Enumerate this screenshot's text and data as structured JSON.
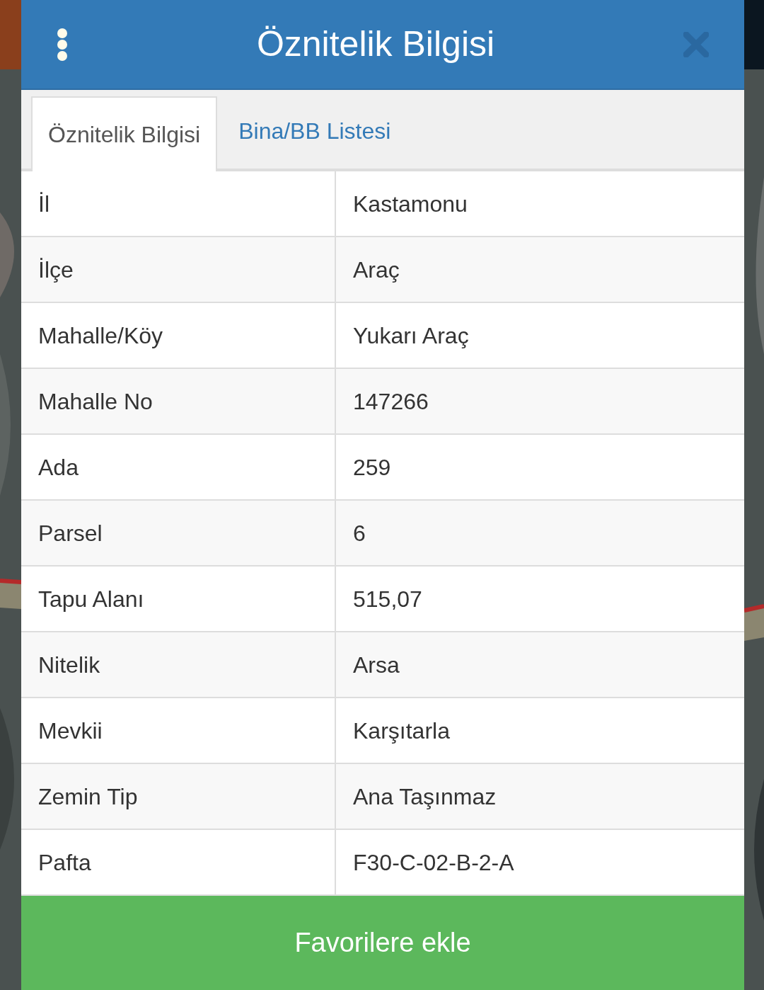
{
  "dialog": {
    "title": "Öznitelik Bilgisi"
  },
  "tabs": [
    {
      "label": "Öznitelik Bilgisi",
      "selected": true
    },
    {
      "label": "Bina/BB Listesi",
      "selected": false
    }
  ],
  "table": {
    "rows": [
      {
        "label": "İl",
        "value": "Kastamonu"
      },
      {
        "label": "İlçe",
        "value": "Araç"
      },
      {
        "label": "Mahalle/Köy",
        "value": "Yukarı Araç"
      },
      {
        "label": "Mahalle No",
        "value": "147266"
      },
      {
        "label": "Ada",
        "value": "259"
      },
      {
        "label": "Parsel",
        "value": "6"
      },
      {
        "label": "Tapu Alanı",
        "value": "515,07"
      },
      {
        "label": "Nitelik",
        "value": "Arsa"
      },
      {
        "label": "Mevkii",
        "value": "Karşıtarla"
      },
      {
        "label": "Zemin Tip",
        "value": "Ana Taşınmaz"
      },
      {
        "label": "Pafta",
        "value": "F30-C-02-B-2-A"
      }
    ]
  },
  "button": {
    "label": "Favorilere ekle"
  }
}
